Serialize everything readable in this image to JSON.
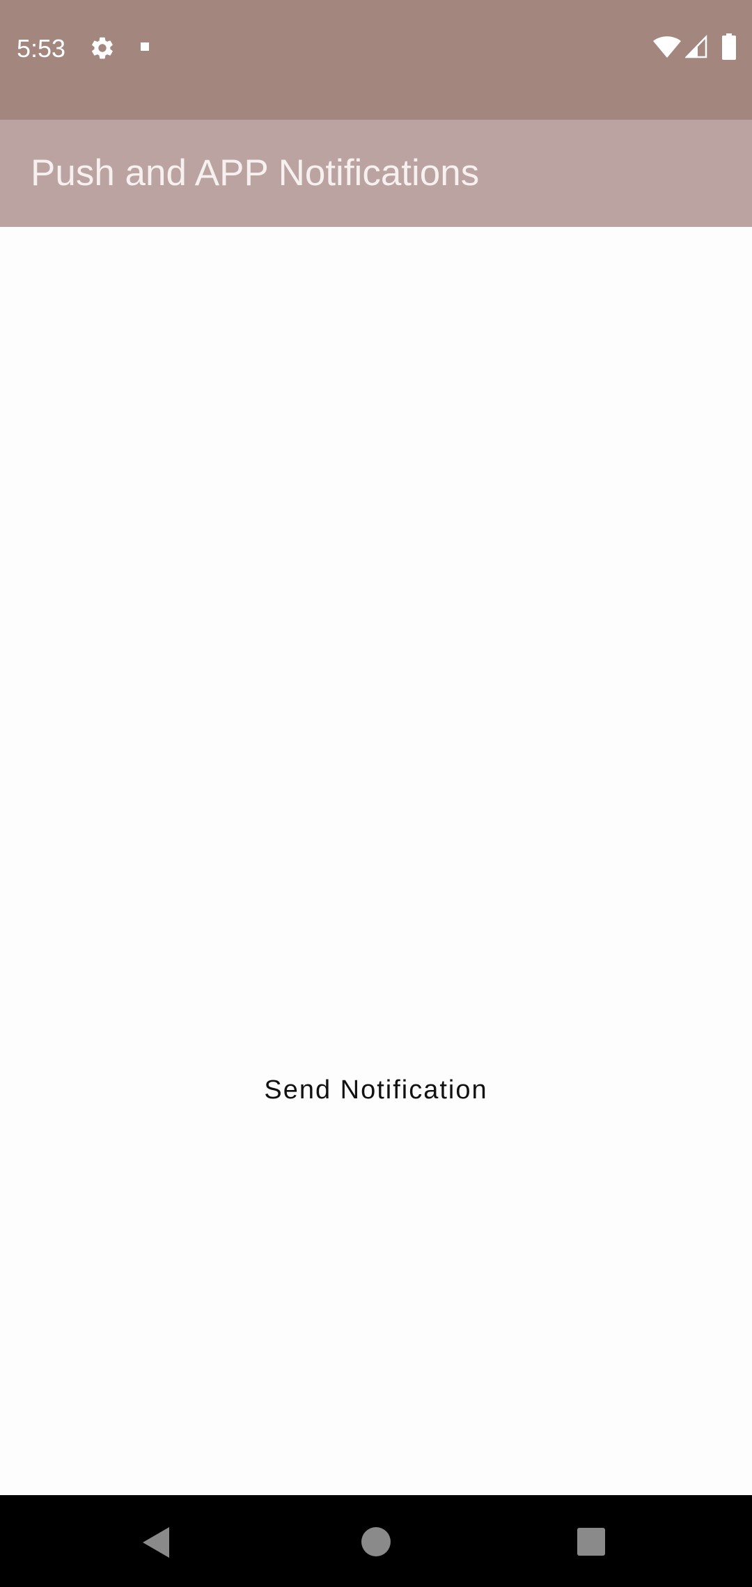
{
  "status_bar": {
    "time": "5:53",
    "icons": [
      "gear-icon",
      "notification-dot-icon",
      "wifi-icon",
      "cell-signal-icon",
      "battery-icon"
    ]
  },
  "app_bar": {
    "title": "Push and APP Notifications"
  },
  "main": {
    "send_button_label": "Send Notification"
  },
  "nav_bar": {
    "icons": [
      "back-icon",
      "home-icon",
      "recents-icon"
    ]
  },
  "colors": {
    "status_bar": "#a3877f",
    "app_bar": "#baa3a0",
    "background": "#fdfdfd",
    "nav_bar": "#000000"
  }
}
